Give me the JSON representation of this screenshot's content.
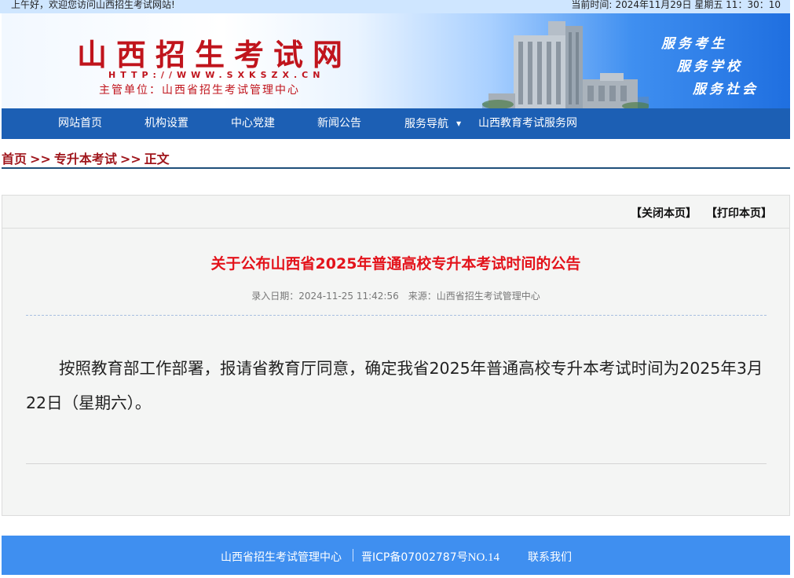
{
  "topbar": {
    "greeting": "上午好，欢迎您访问山西招生考试网站!",
    "time_label": "当前时间:",
    "time_value": "2024年11月29日 星期五 11：30：10"
  },
  "banner": {
    "title": "山西招生考试网",
    "url": "HTTP://WWW.SXKSZX.CN",
    "org": "主管单位：山西省招生考试管理中心",
    "slogans": [
      "服务考生",
      "服务学校",
      "服务社会"
    ]
  },
  "nav": {
    "items": [
      {
        "label": "网站首页"
      },
      {
        "label": "机构设置"
      },
      {
        "label": "中心党建"
      },
      {
        "label": "新闻公告"
      },
      {
        "label": "服务导航",
        "dropdown": true
      },
      {
        "label": "山西教育考试服务网"
      }
    ]
  },
  "breadcrumb": {
    "items": [
      "首页",
      "专升本考试",
      "正文"
    ],
    "separator": ">>"
  },
  "article": {
    "close_label": "【关闭本页】",
    "print_label": "【打印本页】",
    "title": "关于公布山西省2025年普通高校专升本考试时间的公告",
    "date": "录入日期：2024-11-25 11:42:56",
    "source": "来源：山西省招生考试管理中心",
    "body": "按照教育部工作部署，报请省教育厅同意，确定我省2025年普通高校专升本考试时间为2025年3月22日（星期六）。"
  },
  "footer": {
    "org": "山西省招生考试管理中心",
    "icp_prefix": "晋ICP备07002787号",
    "icp_suffix": "NO.14",
    "contact": "联系我们"
  },
  "colors": {
    "nav_bg": "#1c5fb4",
    "title_red": "#e3131b",
    "breadcrumb_red": "#a0171d",
    "footer_bg": "#3f8ff0",
    "topbar_bg": "#cfe6ff"
  }
}
